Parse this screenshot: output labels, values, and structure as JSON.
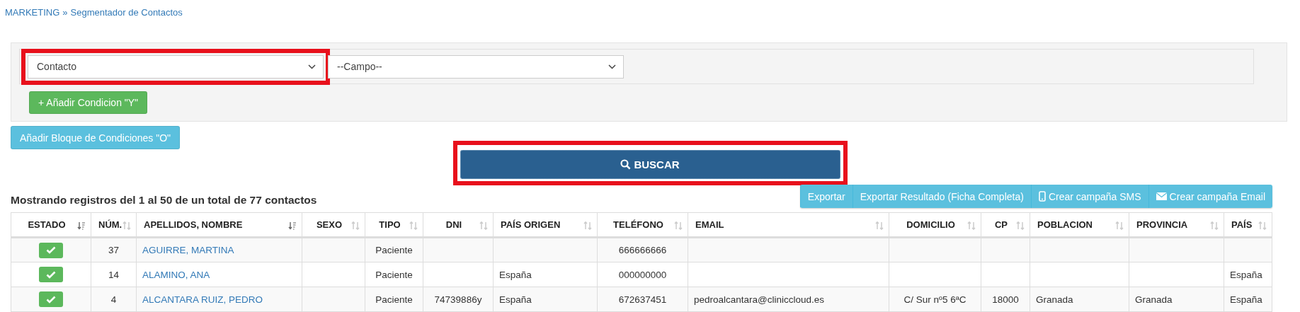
{
  "breadcrumb": {
    "parent": "MARKETING",
    "separator": "»",
    "current": "Segmentador de Contactos"
  },
  "filters": {
    "selects": [
      {
        "value": "Contacto",
        "highlighted": true
      },
      {
        "value": "--Campo--",
        "highlighted": false
      }
    ],
    "add_condition_button": "+ Añadir Condicion \"Y\"",
    "add_block_button": "Añadir Bloque de Condiciones \"O\""
  },
  "search_button": {
    "label": "BUSCAR",
    "highlighted": true
  },
  "summary": "Mostrando registros del 1 al 50 de un total de 77 contactos",
  "actions": [
    {
      "label": "Exportar",
      "kind": "plain"
    },
    {
      "label": "Exportar Resultado (Ficha Completa)",
      "kind": "plain"
    },
    {
      "label": "Crear campaña SMS",
      "kind": "phone"
    },
    {
      "label": "Crear campaña Email",
      "kind": "mail"
    }
  ],
  "table": {
    "columns": [
      {
        "label": "ESTADO",
        "sorted": true
      },
      {
        "label": "NÚM.",
        "sorted": false
      },
      {
        "label": "APELLIDOS, NOMBRE",
        "sorted": true
      },
      {
        "label": "SEXO",
        "sorted": false
      },
      {
        "label": "TIPO",
        "sorted": false
      },
      {
        "label": "DNI",
        "sorted": false
      },
      {
        "label": "PAÍS ORIGEN",
        "sorted": false
      },
      {
        "label": "TELÉFONO",
        "sorted": false
      },
      {
        "label": "EMAIL",
        "sorted": false
      },
      {
        "label": "DOMICILIO",
        "sorted": false
      },
      {
        "label": "CP",
        "sorted": false
      },
      {
        "label": "POBLACION",
        "sorted": false
      },
      {
        "label": "PROVINCIA",
        "sorted": false
      },
      {
        "label": "PAÍS",
        "sorted": false
      }
    ],
    "rows": [
      {
        "active": true,
        "num": "37",
        "name": "AGUIRRE, MARTINA",
        "sexo": "",
        "tipo": "Paciente",
        "dni": "",
        "pais_origen": "",
        "telefono": "666666666",
        "email": "",
        "domicilio": "",
        "cp": "",
        "poblacion": "",
        "provincia": "",
        "pais": ""
      },
      {
        "active": true,
        "num": "14",
        "name": "ALAMINO, ANA",
        "sexo": "",
        "tipo": "Paciente",
        "dni": "",
        "pais_origen": "España",
        "telefono": "000000000",
        "email": "",
        "domicilio": "",
        "cp": "",
        "poblacion": "",
        "provincia": "",
        "pais": "España"
      },
      {
        "active": true,
        "num": "4",
        "name": "ALCANTARA RUIZ, PEDRO",
        "sexo": "",
        "tipo": "Paciente",
        "dni": "74739886y",
        "pais_origen": "España",
        "telefono": "672637451",
        "email": "pedroalcantara@cliniccloud.es",
        "domicilio": "C/ Sur nº5 6ªC",
        "cp": "18000",
        "poblacion": "Granada",
        "provincia": "Granada",
        "pais": "España"
      }
    ]
  }
}
